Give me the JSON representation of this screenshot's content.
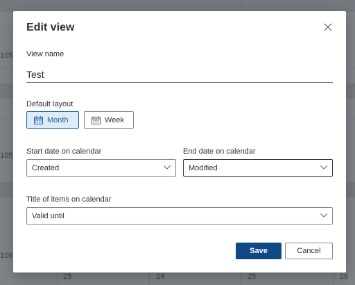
{
  "background": {
    "row_numbers": [
      "105",
      "105",
      "106"
    ],
    "dates": [
      "25",
      "24",
      "25",
      "26"
    ]
  },
  "dialog": {
    "title": "Edit view",
    "close_icon": "close-icon",
    "view_name_label": "View name",
    "view_name_value": "Test",
    "default_layout_label": "Default layout",
    "layout_options": [
      {
        "label": "Month",
        "icon": "calendar-icon",
        "selected": true
      },
      {
        "label": "Week",
        "icon": "calendar-icon",
        "selected": false
      }
    ],
    "start_date_label": "Start date on calendar",
    "start_date_value": "Created",
    "end_date_label": "End date on calendar",
    "end_date_value": "Modified",
    "title_items_label": "Title of items on calendar",
    "title_items_value": "Valid until",
    "save_label": "Save",
    "cancel_label": "Cancel"
  },
  "colors": {
    "primary": "#0f4a86",
    "selected_bg": "#deecf9",
    "overlay": "#7f8388"
  }
}
